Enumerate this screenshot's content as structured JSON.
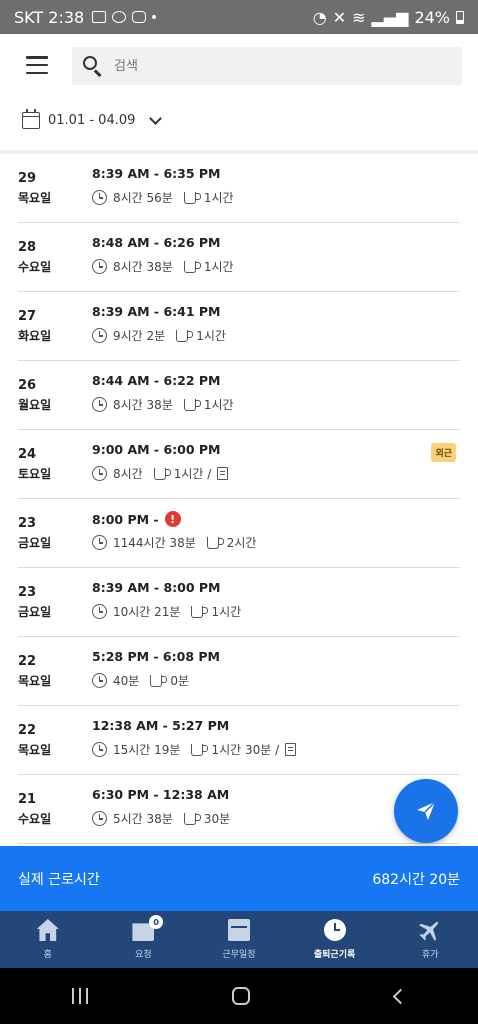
{
  "status_bar": {
    "carrier_time": "SKT 2:38",
    "battery": "24%"
  },
  "header": {
    "search_placeholder": "검색",
    "date_range": "01.01 - 04.09"
  },
  "records": [
    {
      "day": "29",
      "weekday": "목요일",
      "time_range": "8:39 AM - 6:35 PM",
      "work": "8시간 56분",
      "break": "1시간",
      "memo": false,
      "alert": false,
      "tag": ""
    },
    {
      "day": "28",
      "weekday": "수요일",
      "time_range": "8:48 AM - 6:26 PM",
      "work": "8시간 38분",
      "break": "1시간",
      "memo": false,
      "alert": false,
      "tag": ""
    },
    {
      "day": "27",
      "weekday": "화요일",
      "time_range": "8:39 AM - 6:41 PM",
      "work": "9시간 2분",
      "break": "1시간",
      "memo": false,
      "alert": false,
      "tag": ""
    },
    {
      "day": "26",
      "weekday": "월요일",
      "time_range": "8:44 AM - 6:22 PM",
      "work": "8시간 38분",
      "break": "1시간",
      "memo": false,
      "alert": false,
      "tag": ""
    },
    {
      "day": "24",
      "weekday": "토요일",
      "time_range": "9:00 AM - 6:00 PM",
      "work": "8시간",
      "break": "1시간 /",
      "memo": true,
      "alert": false,
      "tag": "외근"
    },
    {
      "day": "23",
      "weekday": "금요일",
      "time_range": "8:00 PM -",
      "work": "1144시간 38분",
      "break": "2시간",
      "memo": false,
      "alert": true,
      "tag": ""
    },
    {
      "day": "23",
      "weekday": "금요일",
      "time_range": "8:39 AM - 8:00 PM",
      "work": "10시간 21분",
      "break": "1시간",
      "memo": false,
      "alert": false,
      "tag": ""
    },
    {
      "day": "22",
      "weekday": "목요일",
      "time_range": "5:28 PM - 6:08 PM",
      "work": "40분",
      "break": "0분",
      "memo": false,
      "alert": false,
      "tag": ""
    },
    {
      "day": "22",
      "weekday": "목요일",
      "time_range": "12:38 AM - 5:27 PM",
      "work": "15시간 19분",
      "break": "1시간 30분 /",
      "memo": true,
      "alert": false,
      "tag": ""
    },
    {
      "day": "21",
      "weekday": "수요일",
      "time_range": "6:30 PM - 12:38 AM",
      "work": "5시간 38분",
      "break": "30분",
      "memo": false,
      "alert": false,
      "tag": ""
    }
  ],
  "summary": {
    "label": "실제 근로시간",
    "value": "682시간 20분"
  },
  "tabs": [
    {
      "label": "홈",
      "icon": "home-icon",
      "active": false
    },
    {
      "label": "요청",
      "icon": "inbox-icon",
      "active": false,
      "badge": "0"
    },
    {
      "label": "근무일정",
      "icon": "calendar-icon",
      "active": false
    },
    {
      "label": "출퇴근기록",
      "icon": "clock-icon",
      "active": true
    },
    {
      "label": "휴가",
      "icon": "plane-icon",
      "active": false
    }
  ],
  "colors": {
    "accent": "#1777f2",
    "tab_bar": "#24477a",
    "alert": "#e53935",
    "tag": "#f7d27a"
  }
}
